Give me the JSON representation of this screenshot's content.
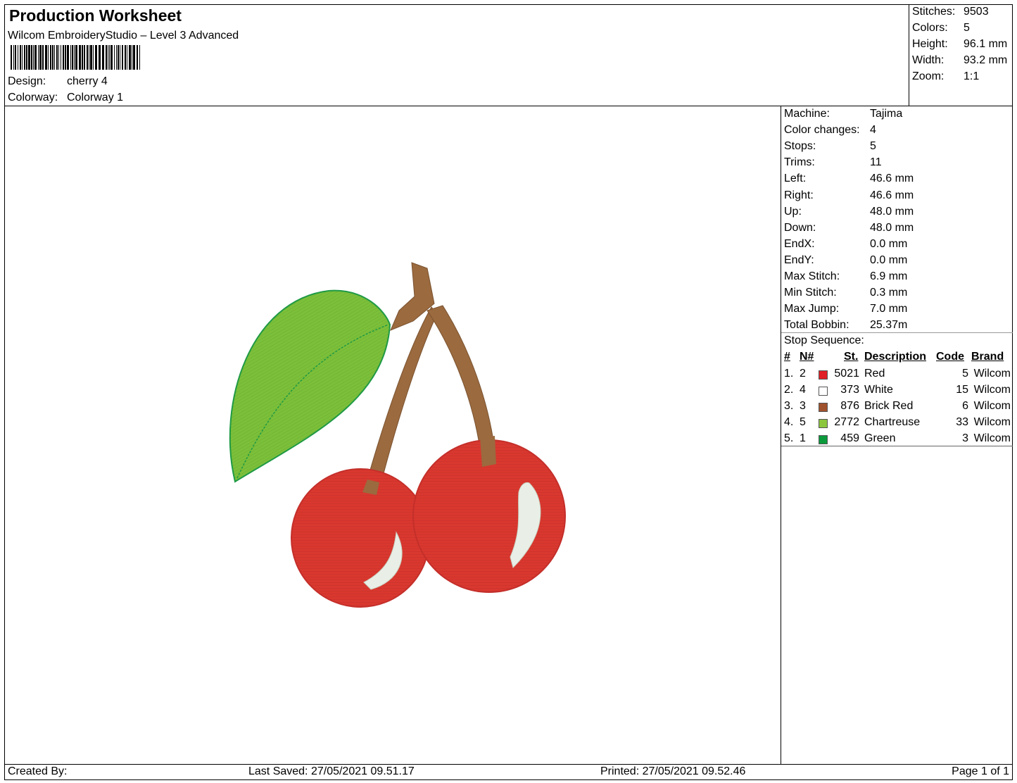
{
  "header": {
    "title": "Production Worksheet",
    "subtitle": "Wilcom EmbroideryStudio – Level 3 Advanced",
    "design_label": "Design:",
    "design_value": "cherry 4",
    "colorway_label": "Colorway:",
    "colorway_value": "Colorway 1"
  },
  "stats": [
    {
      "label": "Stitches:",
      "value": "9503"
    },
    {
      "label": "Colors:",
      "value": "5"
    },
    {
      "label": "Height:",
      "value": "96.1 mm"
    },
    {
      "label": "Width:",
      "value": "93.2 mm"
    },
    {
      "label": "Zoom:",
      "value": "1:1"
    }
  ],
  "machine_info": [
    {
      "label": "Machine:",
      "value": "Tajima"
    },
    {
      "label": "Color changes:",
      "value": "4"
    },
    {
      "label": "Stops:",
      "value": "5"
    },
    {
      "label": "Trims:",
      "value": "11"
    },
    {
      "label": "Left:",
      "value": "46.6 mm"
    },
    {
      "label": "Right:",
      "value": "46.6 mm"
    },
    {
      "label": "Up:",
      "value": "48.0 mm"
    },
    {
      "label": "Down:",
      "value": "48.0 mm"
    },
    {
      "label": "EndX:",
      "value": "0.0 mm"
    },
    {
      "label": "EndY:",
      "value": "0.0 mm"
    },
    {
      "label": "Max Stitch:",
      "value": "6.9 mm"
    },
    {
      "label": "Min Stitch:",
      "value": "0.3 mm"
    },
    {
      "label": "Max Jump:",
      "value": "7.0 mm"
    },
    {
      "label": "Total Bobbin:",
      "value": "25.37m"
    }
  ],
  "stop_sequence": {
    "title": "Stop Sequence:",
    "headers": {
      "num": "#",
      "n": "N#",
      "st": "St.",
      "description": "Description",
      "code": "Code",
      "brand": "Brand"
    },
    "rows": [
      {
        "num": "1.",
        "n": "2",
        "color": "#e01f26",
        "st": "5021",
        "description": "Red",
        "code": "5",
        "brand": "Wilcom"
      },
      {
        "num": "2.",
        "n": "4",
        "color": "#ffffff",
        "st": "373",
        "description": "White",
        "code": "15",
        "brand": "Wilcom"
      },
      {
        "num": "3.",
        "n": "3",
        "color": "#a0522d",
        "st": "876",
        "description": "Brick Red",
        "code": "6",
        "brand": "Wilcom"
      },
      {
        "num": "4.",
        "n": "5",
        "color": "#8cc63f",
        "st": "2772",
        "description": "Chartreuse",
        "code": "33",
        "brand": "Wilcom"
      },
      {
        "num": "5.",
        "n": "1",
        "color": "#0a9a3c",
        "st": "459",
        "description": "Green",
        "code": "3",
        "brand": "Wilcom"
      }
    ]
  },
  "footer": {
    "created_by": "Created By:",
    "last_saved": "Last Saved: 27/05/2021 09.51.17",
    "printed": "Printed: 27/05/2021 09.52.46",
    "page": "Page 1 of 1"
  },
  "design_colors": {
    "cherry": "#d9382f",
    "cherry_dark": "#c42f2a",
    "stem": "#9b6a3e",
    "leaf": "#7cbf3a",
    "leaf_edge": "#1f9a45",
    "highlight": "#e9efe6"
  }
}
